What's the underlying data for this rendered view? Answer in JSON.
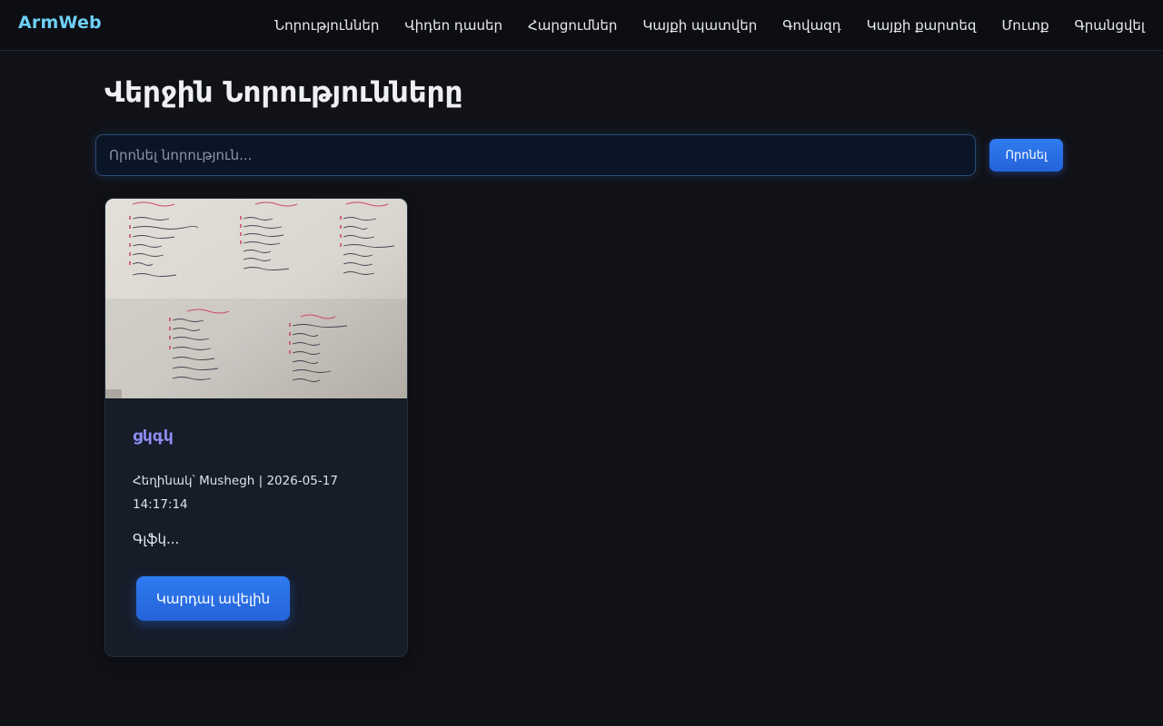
{
  "header": {
    "brand": "ArmWeb",
    "nav": [
      "Նորություններ",
      "Վիդեո դասեր",
      "Հարցումներ",
      "Կայքի պատվեր",
      "Գովազդ",
      "Կայքի քարտեզ",
      "Մուտք",
      "Գրանցվել"
    ]
  },
  "main": {
    "title": "Վերջին Նորությունները",
    "search": {
      "placeholder": "Որոնել նորություն...",
      "value": "",
      "button_label": "Որոնել"
    },
    "posts": [
      {
        "image_icon": "handwritten-notes-photo",
        "title": "ցկգկ",
        "meta": "Հեղինակ՝ Mushegh | 2026-05-17 14:17:14",
        "excerpt": "Գլֆկ...",
        "read_more_label": "Կարդալ ավելին"
      }
    ]
  },
  "colors": {
    "background": "#111218",
    "brand": "#6fd0f6",
    "accent": "#2f7bf0",
    "card_title": "#8d8ff4"
  }
}
